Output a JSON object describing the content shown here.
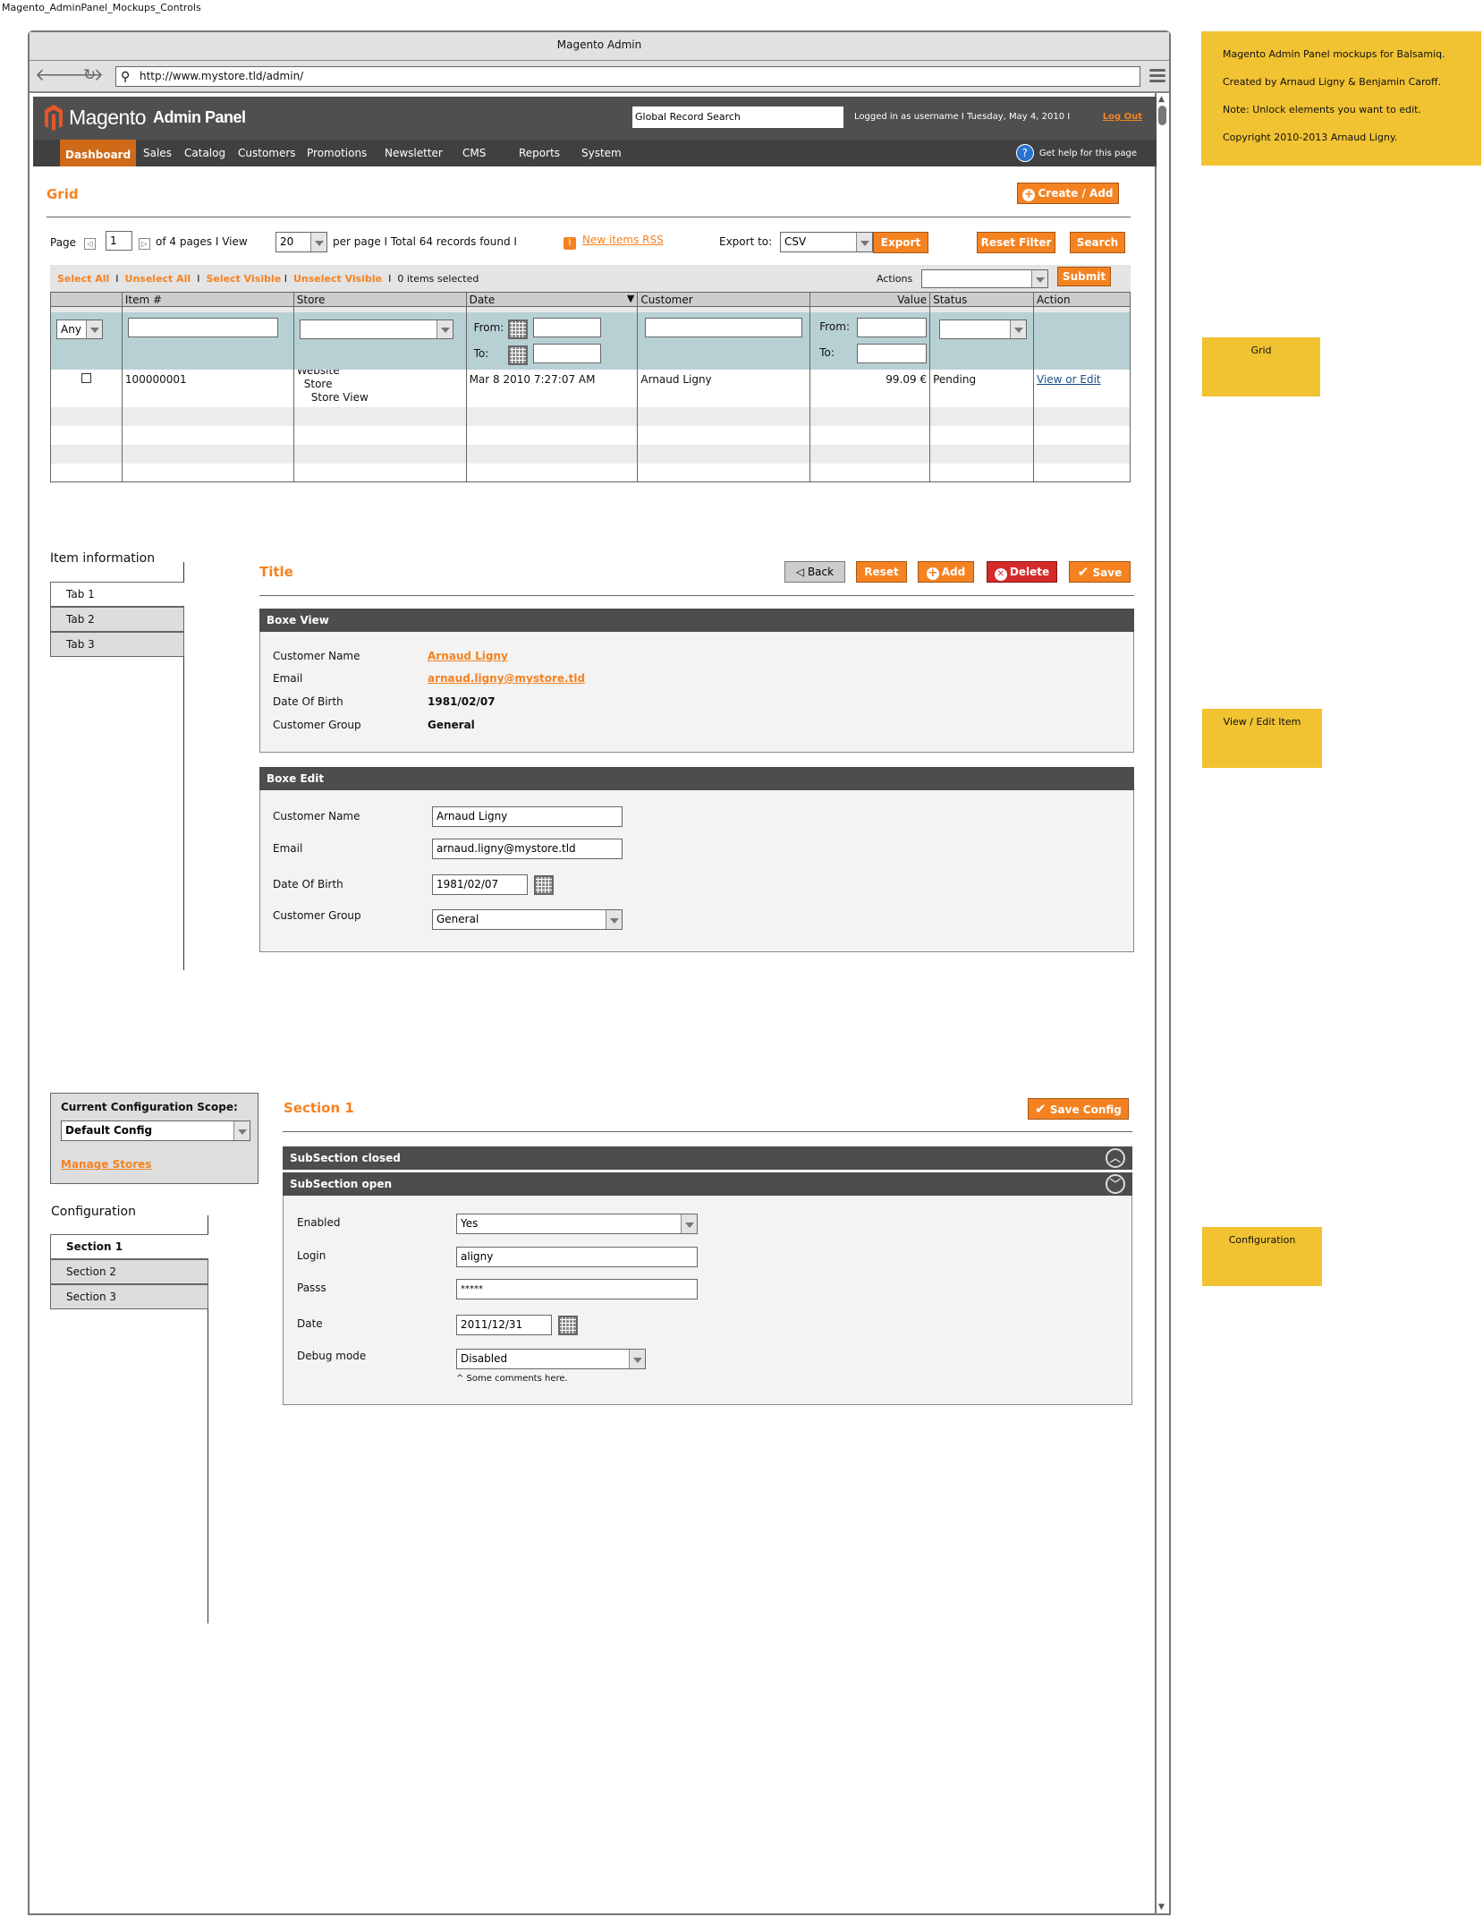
{
  "document_title": "Magento_AdminPanel_Mockups_Controls",
  "browser": {
    "window_title": "Magento Admin",
    "url": "http://www.mystore.tld/admin/"
  },
  "header": {
    "logo_text": "Magento",
    "logo_sub": "Admin Panel",
    "global_search": "Global Record Search",
    "user_info": "Logged in as username  I  Tuesday, May 4, 2010  I",
    "logout": "Log Out",
    "help": "Get help for this page"
  },
  "nav": {
    "items": [
      "Dashboard",
      "Sales",
      "Catalog",
      "Customers",
      "Promotions",
      "Newsletter",
      "CMS",
      "Reports",
      "System"
    ],
    "active": "Dashboard"
  },
  "grid": {
    "title": "Grid",
    "create_button": "Create / Add",
    "pager": {
      "page_label": "Page",
      "page_value": "1",
      "of_pages": "of 4 pages  I  View",
      "per_page_value": "20",
      "per_page_label": "per page  I  Total 64 records found  I"
    },
    "rss_link": "New items RSS",
    "export_label": "Export to:",
    "export_value": "CSV",
    "export_button": "Export",
    "reset_filter_button": "Reset Filter",
    "search_button": "Search",
    "massaction": {
      "select_all": "Select All",
      "unselect_all": "Unselect All",
      "select_visible": "Select Visible",
      "unselect_visible": "Unselect Visible",
      "sep": "I",
      "selected_count": "0 items selected",
      "actions_label": "Actions",
      "actions_value": "",
      "submit": "Submit"
    },
    "columns": [
      "",
      "Item #",
      "Store",
      "Date",
      "Customer",
      "Value",
      "Status",
      "Action"
    ],
    "filters": {
      "checkbox_filter": "Any",
      "from_label": "From:",
      "to_label": "To:"
    },
    "rows": [
      {
        "item": "100000001",
        "store": [
          "Website",
          "Store",
          "Store View"
        ],
        "date": "Mar 8 2010 7:27:07 AM",
        "customer": "Arnaud Ligny",
        "value": "99.09 €",
        "status": "Pending",
        "action": "View or Edit"
      }
    ]
  },
  "item_view": {
    "sidebar_title": "Item information",
    "tabs": [
      "Tab 1",
      "Tab 2",
      "Tab 3"
    ],
    "active_tab": "Tab 1",
    "title": "Title",
    "buttons": {
      "back": "Back",
      "reset": "Reset",
      "add": "Add",
      "delete": "Delete",
      "save": "Save"
    },
    "box_view": {
      "header": "Boxe View",
      "fields": [
        {
          "label": "Customer Name",
          "value": "Arnaud Ligny"
        },
        {
          "label": "Email",
          "value": "arnaud.ligny@mystore.tld"
        },
        {
          "label": "Date Of Birth",
          "value": "1981/02/07"
        },
        {
          "label": "Customer Group",
          "value": "General"
        }
      ]
    },
    "box_edit": {
      "header": "Boxe Edit",
      "fields": [
        {
          "label": "Customer Name",
          "value": "Arnaud Ligny"
        },
        {
          "label": "Email",
          "value": "arnaud.ligny@mystore.tld"
        },
        {
          "label": "Date Of Birth",
          "value": "1981/02/07"
        },
        {
          "label": "Customer Group",
          "value": "General"
        }
      ]
    }
  },
  "config": {
    "scope_label": "Current Configuration Scope:",
    "scope_value": "Default Config",
    "manage_stores": "Manage Stores",
    "sidebar_title": "Configuration",
    "sections": [
      "Section 1",
      "Section 2",
      "Section 3"
    ],
    "active_section": "Section 1",
    "title": "Section 1",
    "save_button": "Save Config",
    "subsection_closed": "SubSection closed",
    "subsection_open": "SubSection open",
    "fields": [
      {
        "label": "Enabled",
        "value": "Yes"
      },
      {
        "label": "Login",
        "value": "aligny"
      },
      {
        "label": "Passs",
        "value": "*****"
      },
      {
        "label": "Date",
        "value": "2011/12/31"
      },
      {
        "label": "Debug mode",
        "value": "Disabled"
      }
    ],
    "comment": "^ Some comments here."
  },
  "notes": {
    "intro": [
      "Magento Admin Panel mockups for Balsamiq.",
      "Created by Arnaud Ligny & Benjamin Caroff.",
      "Note: Unlock elements you want to edit.",
      "Copyright 2010-2013 Arnaud Ligny."
    ],
    "grid": "Grid",
    "view_edit": "View / Edit Item",
    "configuration": "Configuration"
  },
  "colors": {
    "accent": "#f58220",
    "nav_active": "#cf6a18",
    "header_bg": "#4f4f4f",
    "filter_row": "#b7d0d4",
    "delete": "#d42a2a",
    "note": "#f1c232",
    "link_blue": "#1a4f8a"
  }
}
